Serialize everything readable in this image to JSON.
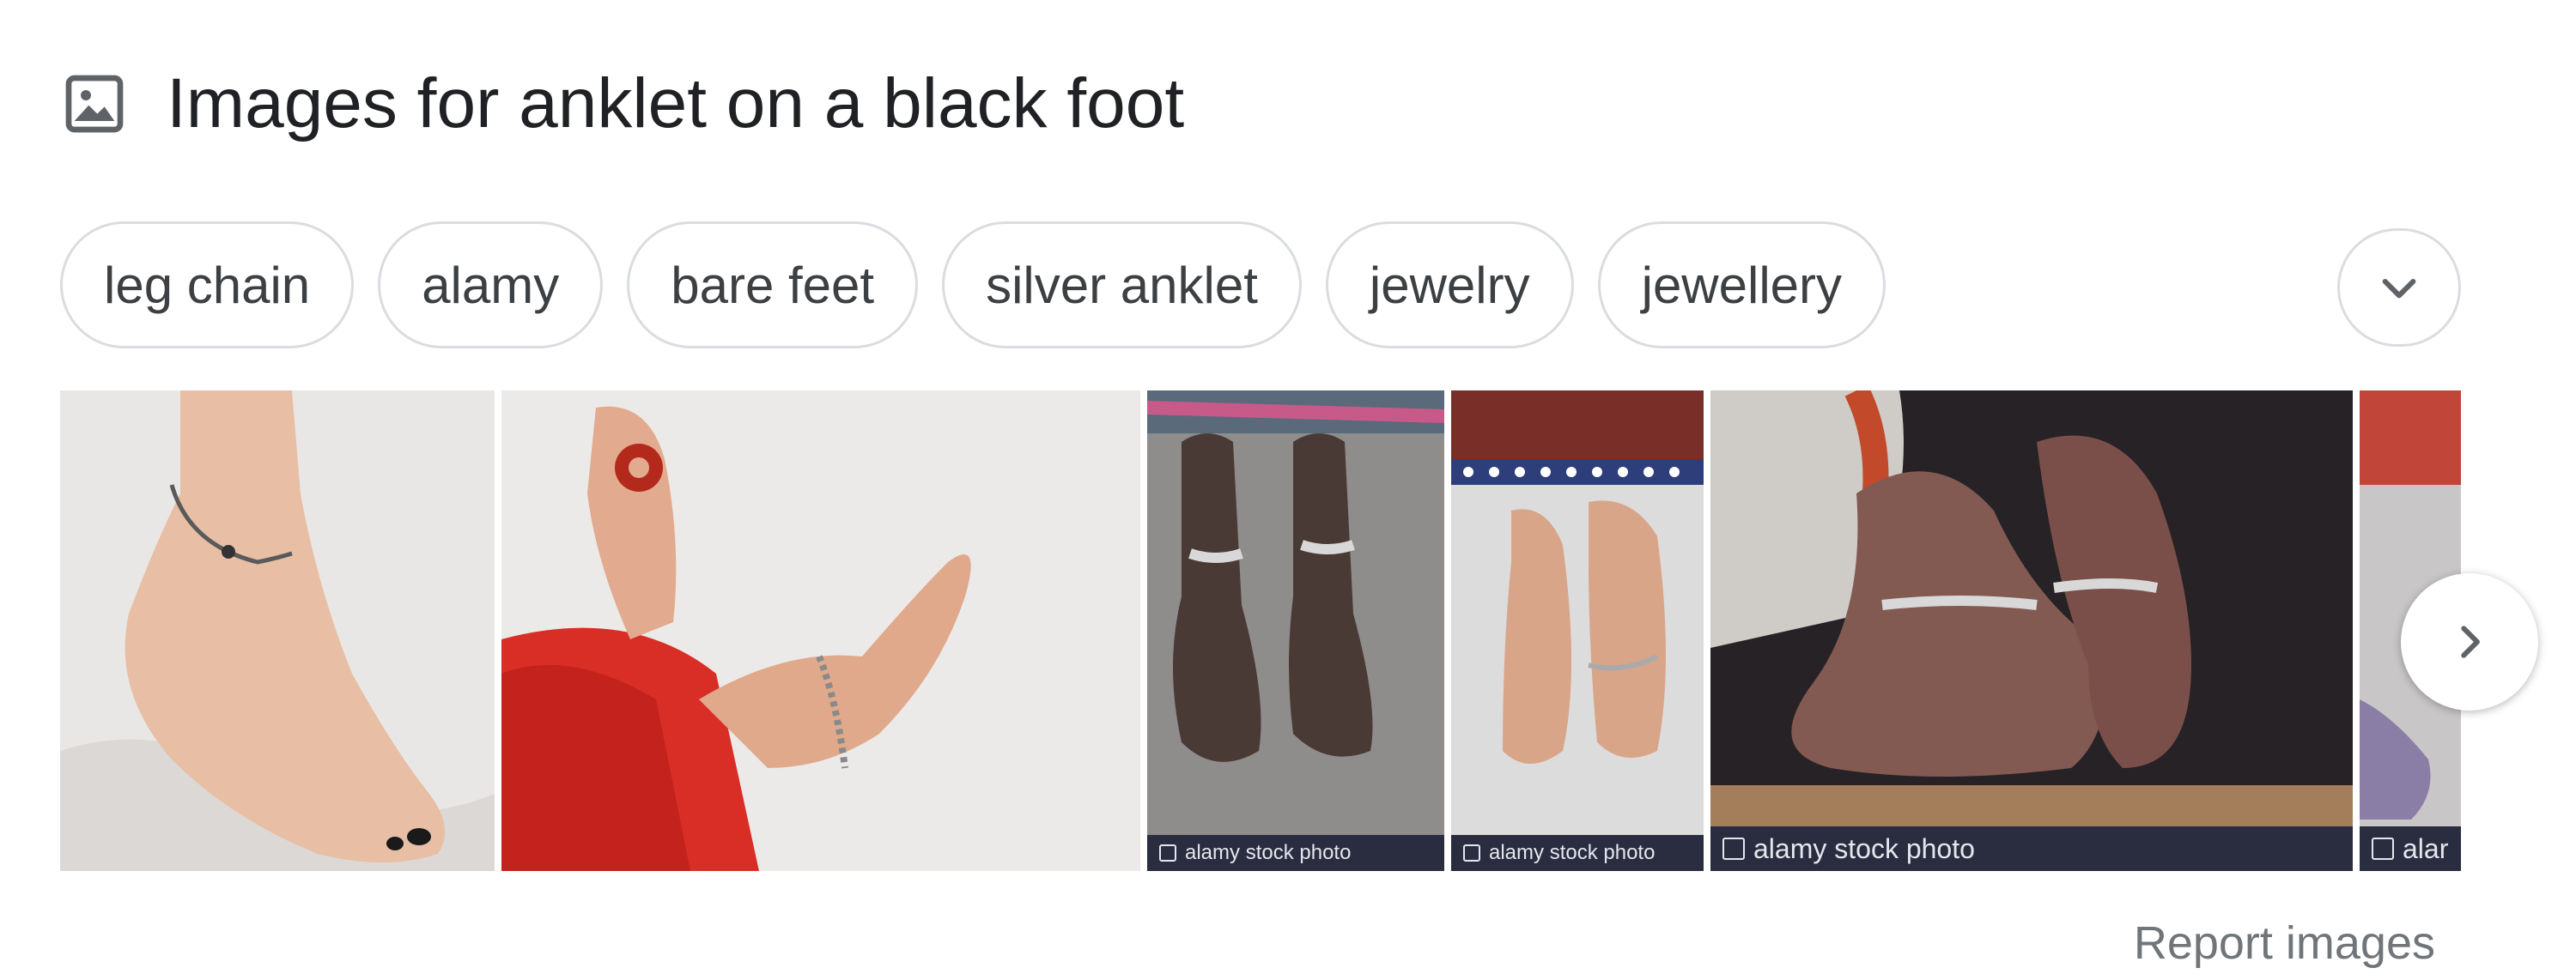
{
  "header": {
    "icon": "image-icon",
    "title": "Images for anklet on a black foot"
  },
  "chips": [
    {
      "label": "leg chain"
    },
    {
      "label": "alamy"
    },
    {
      "label": "bare feet"
    },
    {
      "label": "silver anklet"
    },
    {
      "label": "jewelry"
    },
    {
      "label": "jewellery"
    }
  ],
  "expand_icon": "chevron-down-icon",
  "images": [
    {
      "caption": ""
    },
    {
      "caption": ""
    },
    {
      "caption": "alamy stock photo"
    },
    {
      "caption": "alamy stock photo"
    },
    {
      "caption": "alamy stock photo"
    },
    {
      "caption": "alar"
    }
  ],
  "next_icon": "chevron-right-icon",
  "report_link": "Report images",
  "colors": {
    "text": "#202124",
    "chip_border": "#dadce0",
    "muted": "#70757a",
    "watermark_bar": "#2a2c40"
  }
}
